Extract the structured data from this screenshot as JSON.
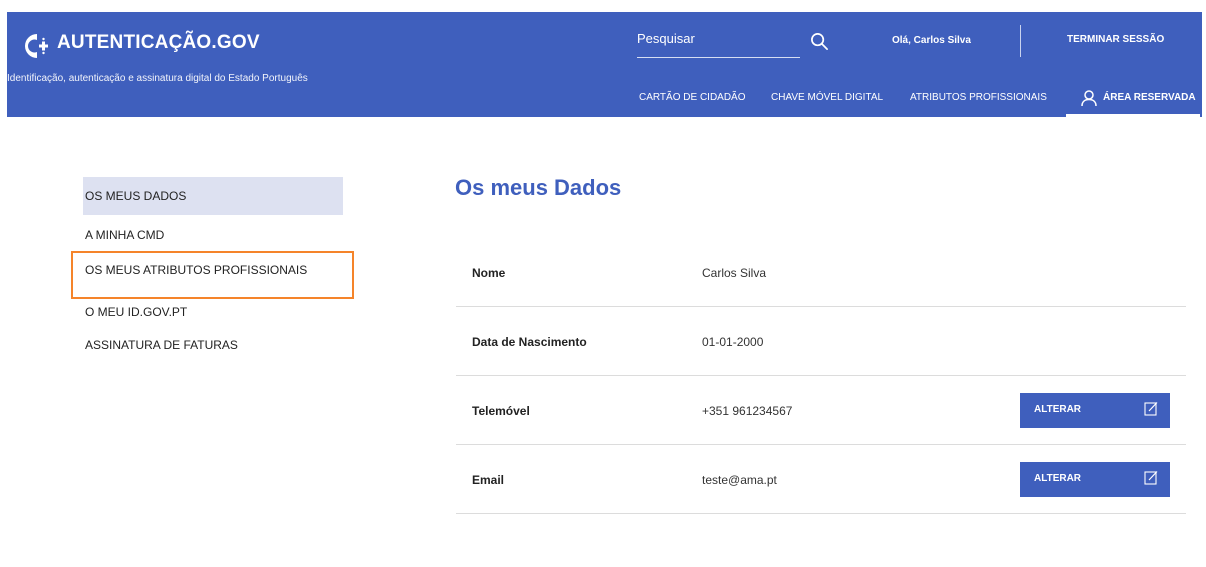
{
  "header": {
    "brand": "AUTENTICAÇÃO.GOV",
    "tagline": "Identificação, autenticação e assinatura digital do Estado Português",
    "search_placeholder": "Pesquisar",
    "greeting": "Olá, Carlos Silva",
    "logout": "TERMINAR SESSÃO",
    "nav": [
      {
        "label": "CARTÃO DE CIDADÃO"
      },
      {
        "label": "CHAVE MÓVEL DIGITAL"
      },
      {
        "label": "ATRIBUTOS PROFISSIONAIS"
      },
      {
        "label": "ÁREA RESERVADA",
        "active": true
      }
    ]
  },
  "sidebar": {
    "items": [
      {
        "label": "OS MEUS DADOS",
        "active": true
      },
      {
        "label": "A MINHA CMD"
      },
      {
        "label": "OS MEUS ATRIBUTOS PROFISSIONAIS",
        "highlighted": true
      },
      {
        "label": "O MEU ID.GOV.PT"
      },
      {
        "label": "ASSINATURA DE FATURAS"
      }
    ]
  },
  "main": {
    "title": "Os meus Dados",
    "rows": [
      {
        "label": "Nome",
        "value": "Carlos Silva"
      },
      {
        "label": "Data de Nascimento",
        "value": "01-01-2000"
      },
      {
        "label": "Telemóvel",
        "value": "+351 961234567",
        "action": "ALTERAR"
      },
      {
        "label": "Email",
        "value": "teste@ama.pt",
        "action": "ALTERAR"
      }
    ]
  },
  "colors": {
    "primary": "#3f5fbd",
    "sidebar_active": "#dde1f1",
    "highlight": "#f5842a"
  },
  "icons": [
    "logo-icon",
    "search-icon",
    "user-icon",
    "edit-icon"
  ]
}
